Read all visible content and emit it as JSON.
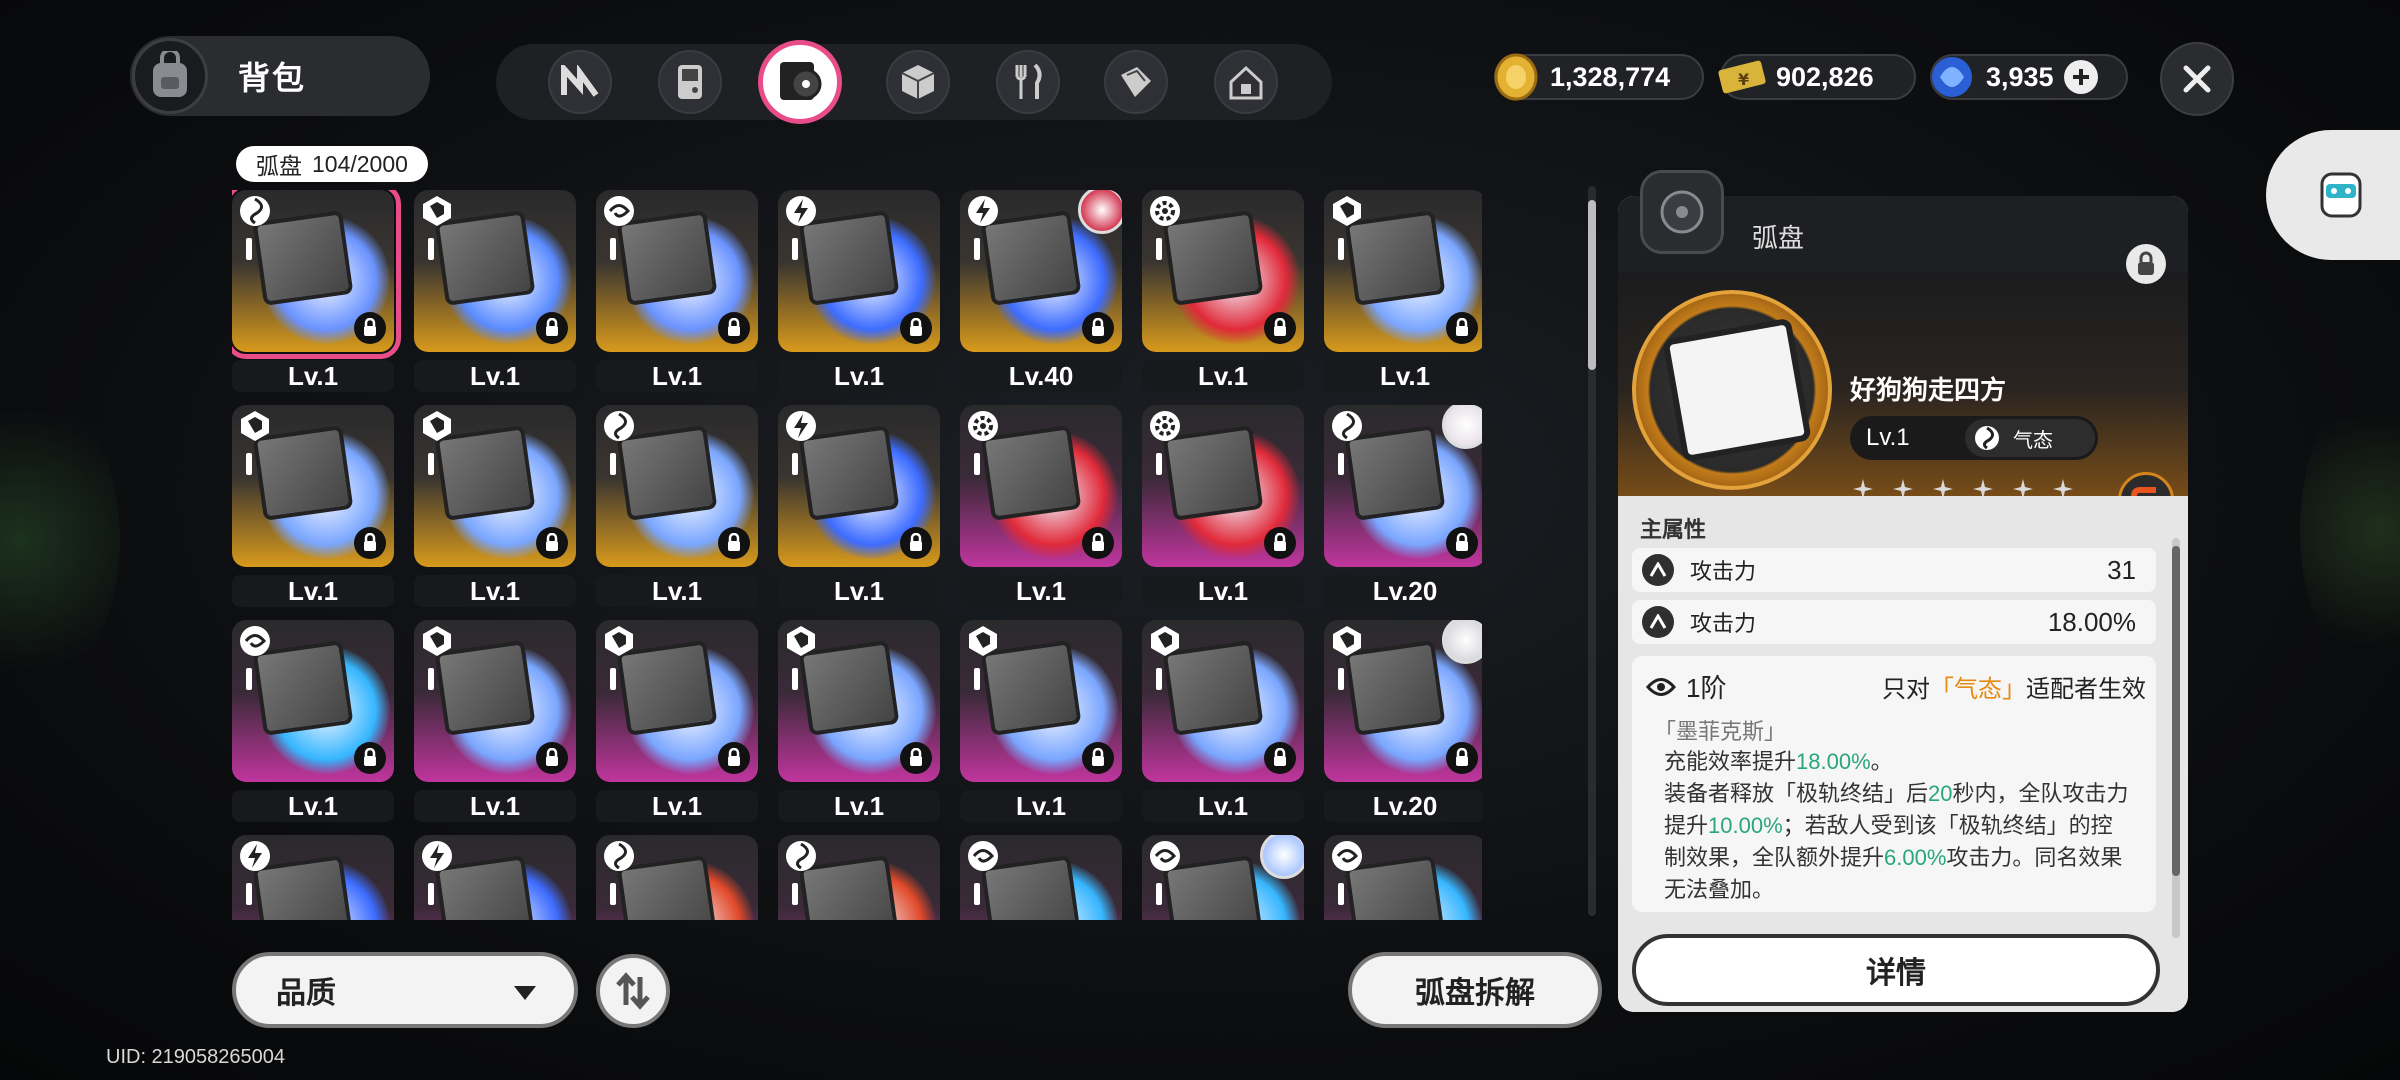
{
  "header": {
    "bag_title": "背包",
    "tabs": [
      {
        "id": "drive",
        "icon": "n-logo-icon"
      },
      {
        "id": "gadget",
        "icon": "gameboy-icon"
      },
      {
        "id": "disc",
        "icon": "disc-icon",
        "active": true
      },
      {
        "id": "box",
        "icon": "cube-icon"
      },
      {
        "id": "food",
        "icon": "fork-knife-icon"
      },
      {
        "id": "cards",
        "icon": "card-stack-icon"
      },
      {
        "id": "home",
        "icon": "home-icon"
      }
    ],
    "currencies": [
      {
        "icon": "gold-coin-icon",
        "value": "1,328,774"
      },
      {
        "icon": "ticket-icon",
        "value": "902,826"
      },
      {
        "icon": "crystal-icon",
        "value": "3,935"
      }
    ]
  },
  "inventory": {
    "category_label": "弧盘",
    "count_label": "104/2000",
    "items": [
      {
        "level": "Lv.1",
        "rarity": "gold",
        "type_icon": "vortex-icon",
        "hue": "#6a93ff",
        "selected": true
      },
      {
        "level": "Lv.1",
        "rarity": "gold",
        "type_icon": "shield-hex-icon",
        "hue": "#5a8bff"
      },
      {
        "level": "Lv.1",
        "rarity": "gold",
        "type_icon": "swirl-icon",
        "hue": "#6a93ff"
      },
      {
        "level": "Lv.1",
        "rarity": "gold",
        "type_icon": "bolt-icon",
        "hue": "#3d6cff"
      },
      {
        "level": "Lv.40",
        "rarity": "gold",
        "type_icon": "bolt-icon",
        "hue": "#3d6cff",
        "avatar": "#d33a55"
      },
      {
        "level": "Lv.1",
        "rarity": "gold",
        "type_icon": "gear-icon",
        "hue": "#e12a3a"
      },
      {
        "level": "Lv.1",
        "rarity": "gold",
        "type_icon": "shield-hex-icon",
        "hue": "#7aa6ff"
      },
      {
        "level": "Lv.1",
        "rarity": "gold",
        "type_icon": "shield-hex-icon",
        "hue": "#7aa6ff"
      },
      {
        "level": "Lv.1",
        "rarity": "gold",
        "type_icon": "shield-hex-icon",
        "hue": "#7aa6ff"
      },
      {
        "level": "Lv.1",
        "rarity": "gold",
        "type_icon": "vortex-icon",
        "hue": "#7aa6ff"
      },
      {
        "level": "Lv.1",
        "rarity": "gold",
        "type_icon": "bolt-icon",
        "hue": "#3d6cff"
      },
      {
        "level": "Lv.1",
        "rarity": "purple",
        "type_icon": "gear-icon",
        "hue": "#e12a3a"
      },
      {
        "level": "Lv.1",
        "rarity": "purple",
        "type_icon": "gear-icon",
        "hue": "#e12a3a"
      },
      {
        "level": "Lv.20",
        "rarity": "purple",
        "type_icon": "vortex-icon",
        "hue": "#7aa6ff",
        "avatar": "#e8e2e8"
      },
      {
        "level": "Lv.1",
        "rarity": "purple",
        "type_icon": "swirl-icon",
        "hue": "#36b6ff"
      },
      {
        "level": "Lv.1",
        "rarity": "purple",
        "type_icon": "shield-hex-icon",
        "hue": "#7aa6ff"
      },
      {
        "level": "Lv.1",
        "rarity": "purple",
        "type_icon": "shield-hex-icon",
        "hue": "#7aa6ff"
      },
      {
        "level": "Lv.1",
        "rarity": "purple",
        "type_icon": "shield-hex-icon",
        "hue": "#7aa6ff"
      },
      {
        "level": "Lv.1",
        "rarity": "purple",
        "type_icon": "shield-hex-icon",
        "hue": "#7aa6ff"
      },
      {
        "level": "Lv.1",
        "rarity": "purple",
        "type_icon": "shield-hex-icon",
        "hue": "#7aa6ff"
      },
      {
        "level": "Lv.20",
        "rarity": "purple",
        "type_icon": "shield-hex-icon",
        "hue": "#7aa6ff",
        "avatar": "#d9d9de"
      },
      {
        "level": "",
        "rarity": "purple",
        "type_icon": "bolt-icon",
        "hue": "#3d6cff"
      },
      {
        "level": "",
        "rarity": "purple",
        "type_icon": "bolt-icon",
        "hue": "#3d6cff"
      },
      {
        "level": "",
        "rarity": "purple",
        "type_icon": "vortex-icon",
        "hue": "#e14a2a"
      },
      {
        "level": "",
        "rarity": "purple",
        "type_icon": "vortex-icon",
        "hue": "#e14a2a"
      },
      {
        "level": "",
        "rarity": "purple",
        "type_icon": "swirl-icon",
        "hue": "#36b6ff"
      },
      {
        "level": "",
        "rarity": "purple",
        "type_icon": "swirl-icon",
        "hue": "#36b6ff",
        "avatar": "#a9c6ff"
      },
      {
        "level": "",
        "rarity": "purple",
        "type_icon": "swirl-icon",
        "hue": "#36b6ff"
      }
    ]
  },
  "footer": {
    "sort_label": "品质",
    "dismantle_label": "弧盘拆解",
    "uid": "UID: 219058265004"
  },
  "detail": {
    "panel_title": "弧盘",
    "name": "好狗狗走四方",
    "level": "Lv.1",
    "attribute": "气态",
    "star_count": 6,
    "main_stat_label": "主属性",
    "stats": [
      {
        "label": "攻击力",
        "value": "31"
      },
      {
        "label": "攻击力",
        "value": "18.00%"
      }
    ],
    "tier_label": "1阶",
    "condition_prefix": "只对",
    "condition_attr": "「气态」",
    "condition_suffix": "适配者生效",
    "effect_name": "「墨菲克斯」",
    "effect_parts": [
      {
        "t": "充能效率提升",
        "c": ""
      },
      {
        "t": "18.00%",
        "c": "green"
      },
      {
        "t": "。",
        "c": ""
      },
      {
        "t": "\n装备者释放「极轨终结」后",
        "c": ""
      },
      {
        "t": "20",
        "c": "green"
      },
      {
        "t": "秒内，全队攻击力提升",
        "c": ""
      },
      {
        "t": "10.00%",
        "c": "green"
      },
      {
        "t": "；若敌人受到该「极轨终结」的控制效果，全队额外提升",
        "c": ""
      },
      {
        "t": "6.00%",
        "c": "green"
      },
      {
        "t": "攻击力。同名效果无法叠加。",
        "c": ""
      }
    ],
    "detail_button": "详情"
  },
  "colors": {
    "accent_pink": "#e84d8a",
    "gold": "#e5a021",
    "purple": "#b5399a",
    "green": "#2aa67a",
    "orange": "#e58a11"
  }
}
